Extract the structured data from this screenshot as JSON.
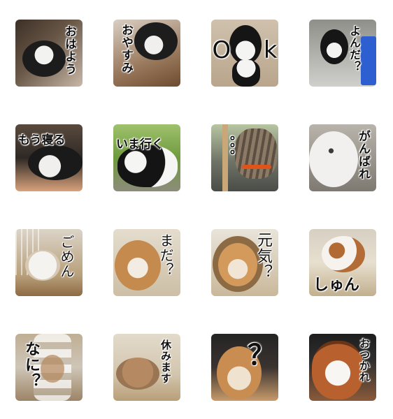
{
  "colors": {
    "page_background": "#ffffff",
    "caption_text": "#111111",
    "caption_outline": "#ffffff"
  },
  "stickers": [
    {
      "caption": "おはよう",
      "subject": "black-and-white-kitten",
      "orientation": "vertical"
    },
    {
      "caption": "おやすみ",
      "subject": "black-and-white-kitten",
      "orientation": "vertical"
    },
    {
      "caption": "O k",
      "subject": "black-and-white-kitten",
      "orientation": "horizontal"
    },
    {
      "caption": "よんだ？",
      "subject": "black-and-white-kitten",
      "orientation": "vertical"
    },
    {
      "caption": "もう寝る",
      "subject": "black-and-white-cat",
      "orientation": "horizontal"
    },
    {
      "caption": "いま行く",
      "subject": "black-and-white-cat",
      "orientation": "horizontal"
    },
    {
      "caption": "。。。",
      "subject": "tabby-cat",
      "orientation": "vertical"
    },
    {
      "caption": "がんばれ",
      "subject": "white-hamster",
      "orientation": "vertical"
    },
    {
      "caption": "ごめん",
      "subject": "white-hamster",
      "orientation": "vertical"
    },
    {
      "caption": "まだ？",
      "subject": "golden-hamster",
      "orientation": "vertical"
    },
    {
      "caption": "元気？",
      "subject": "golden-hamster",
      "orientation": "vertical"
    },
    {
      "caption": "しゅん",
      "subject": "white-brown-hamster",
      "orientation": "horizontal"
    },
    {
      "caption": "なに？",
      "subject": "hamster-bottle",
      "orientation": "vertical"
    },
    {
      "caption": "休みます",
      "subject": "sleeping-hamster",
      "orientation": "vertical"
    },
    {
      "caption": "？",
      "subject": "golden-hamster",
      "orientation": "horizontal"
    },
    {
      "caption": "おつかれ",
      "subject": "papillon-dog",
      "orientation": "vertical"
    }
  ]
}
